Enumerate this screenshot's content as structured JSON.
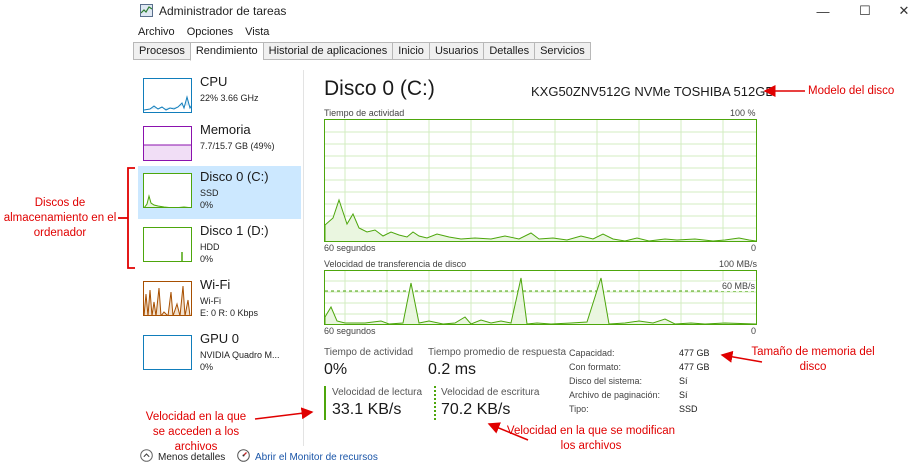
{
  "window": {
    "title": "Administrador de tareas",
    "minimize_glyph": "—",
    "maximize_glyph": "☐",
    "close_glyph": "✕"
  },
  "menu": [
    "Archivo",
    "Opciones",
    "Vista"
  ],
  "tabs": [
    "Procesos",
    "Rendimiento",
    "Historial de aplicaciones",
    "Inicio",
    "Usuarios",
    "Detalles",
    "Servicios"
  ],
  "active_tab": "Rendimiento",
  "sidebar": [
    {
      "title": "CPU",
      "lines": [
        "22% 3.66 GHz"
      ],
      "color": "#117dbb"
    },
    {
      "title": "Memoria",
      "lines": [
        "7.7/15.7 GB (49%)"
      ],
      "color": "#8b12ae"
    },
    {
      "title": "Disco 0 (C:)",
      "lines": [
        "SSD",
        "0%"
      ],
      "color": "#4da60c",
      "selected": true
    },
    {
      "title": "Disco 1 (D:)",
      "lines": [
        "HDD",
        "0%"
      ],
      "color": "#4da60c"
    },
    {
      "title": "Wi-Fi",
      "lines": [
        "Wi-Fi",
        "E: 0 R: 0 Kbps"
      ],
      "color": "#a74f01"
    },
    {
      "title": "GPU 0",
      "lines": [
        "NVIDIA Quadro M...",
        "0%"
      ],
      "color": "#117dbb"
    }
  ],
  "main": {
    "title": "Disco 0 (C:)",
    "model": "KXG50ZNV512G NVMe TOSHIBA 512GB",
    "graph1": {
      "label": "Tiempo de actividad",
      "max": "100 %",
      "time": "60 segundos",
      "min": "0"
    },
    "graph2": {
      "label": "Velocidad de transferencia de disco",
      "max": "100 MB/s",
      "mid": "60 MB/s",
      "time": "60 segundos",
      "min": "0"
    },
    "stats": {
      "activity_label": "Tiempo de actividad",
      "activity_value": "0%",
      "response_label": "Tiempo promedio de respuesta",
      "response_value": "0.2 ms",
      "read_label": "Velocidad de lectura",
      "read_value": "33.1 KB/s",
      "write_label": "Velocidad de escritura",
      "write_value": "70.2 KB/s"
    },
    "properties": [
      {
        "label": "Capacidad:",
        "value": "477 GB"
      },
      {
        "label": "Con formato:",
        "value": "477 GB"
      },
      {
        "label": "Disco del sistema:",
        "value": "Sí"
      },
      {
        "label": "Archivo de paginación:",
        "value": "Sí"
      },
      {
        "label": "Tipo:",
        "value": "SSD"
      }
    ]
  },
  "footer": {
    "less_details": "Menos detalles",
    "resource_monitor": "Abrir el Monitor de recursos"
  },
  "annotations": {
    "model": "Modelo del disco",
    "storage": "Discos de almacenamiento en el ordenador",
    "size": "Tamaño de memoria del disco",
    "read": "Velocidad en la que se acceden a los archivos",
    "write": "Velocidad en la que se modifican los archivos"
  },
  "colors": {
    "disk_accent": "#4da60c",
    "cpu_accent": "#117dbb",
    "memory_accent": "#8b12ae",
    "wifi_accent": "#a74f01",
    "annotation": "#e00000",
    "selected_bg": "#cce8ff"
  }
}
